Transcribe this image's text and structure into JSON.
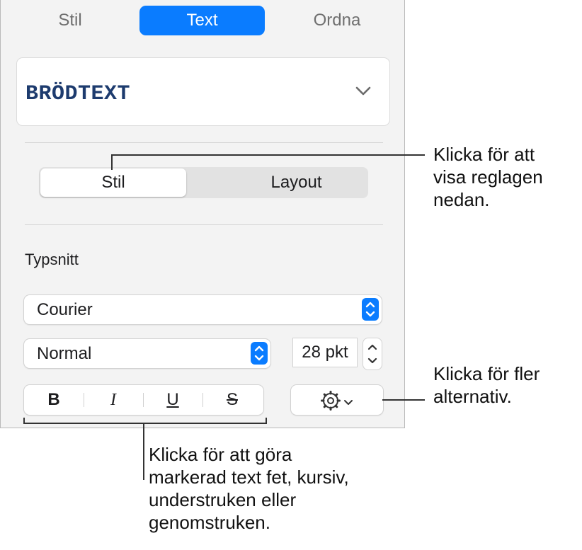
{
  "tabs": [
    {
      "label": "Stil",
      "active": false
    },
    {
      "label": "Text",
      "active": true
    },
    {
      "label": "Ordna",
      "active": false
    }
  ],
  "paragraph_style": {
    "name": "BRÖDTEXT"
  },
  "segmented": {
    "left": "Stil",
    "right": "Layout",
    "selected": "Stil"
  },
  "font_section": {
    "label": "Typsnitt",
    "family": "Courier",
    "typeface": "Normal",
    "size": "28 pkt"
  },
  "format_buttons": {
    "bold": "B",
    "italic": "I",
    "underline": "U",
    "strike": "S"
  },
  "callouts": {
    "segmented": [
      "Klicka för att",
      "visa reglagen",
      "nedan."
    ],
    "more": [
      "Klicka för fler",
      "alternativ."
    ],
    "format": [
      "Klicka för att göra",
      "markerad text fet, kursiv,",
      "understruken eller",
      "genomstruken."
    ]
  },
  "colors": {
    "accent": "#0a7cff",
    "style_text": "#1d3b6e"
  },
  "icons": {
    "paragraph_menu": "chevron-down-icon",
    "popup": "up-down-arrows-icon",
    "more": "gear-icon"
  }
}
